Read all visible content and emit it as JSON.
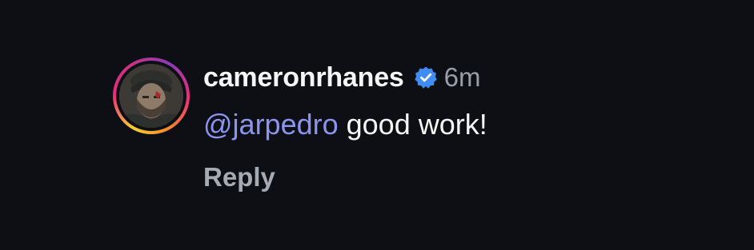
{
  "comment": {
    "username": "cameronrhanes",
    "verified_icon": "verified-badge-icon",
    "time": "6m",
    "mention": "@jarpedro",
    "text": "good work!",
    "reply_label": "Reply"
  },
  "colors": {
    "background": "#0d0f14",
    "mention": "#8c94f0",
    "verified": "#3f8cf2",
    "muted": "#9a9ea6"
  }
}
